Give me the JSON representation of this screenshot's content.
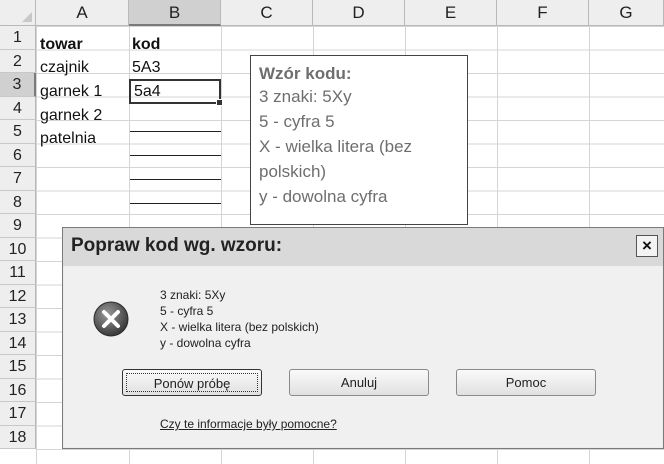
{
  "sheet": {
    "columns": [
      "A",
      "B",
      "C",
      "D",
      "E",
      "F",
      "G"
    ],
    "active_column": "B",
    "rows": [
      "1",
      "2",
      "3",
      "4",
      "5",
      "6",
      "7",
      "8",
      "9",
      "10",
      "11",
      "12",
      "13",
      "14",
      "15",
      "16",
      "17",
      "18"
    ],
    "active_row": "3",
    "cells": {
      "A1": "towar",
      "B1": "kod",
      "A2": "czajnik",
      "B2": "5A3",
      "A3": "garnek 1",
      "B3": "5a4",
      "A4": "garnek 2",
      "A5": "patelnia"
    }
  },
  "input_message": {
    "title": "Wzór kodu:",
    "lines": [
      "3 znaki: 5Xy",
      "5 - cyfra 5",
      "X - wielka litera (bez",
      "polskich)",
      "y - dowolna cyfra"
    ]
  },
  "error_dialog": {
    "title": "Popraw kod wg. wzoru:",
    "close_glyph": "×",
    "icon": "error-x-icon",
    "message_lines": [
      "3 znaki: 5Xy",
      "5 - cyfra 5",
      "X - wielka litera (bez polskich)",
      "y - dowolna cyfra"
    ],
    "buttons": {
      "retry": "Ponów próbę",
      "cancel": "Anuluj",
      "help": "Pomoc"
    },
    "help_link": "Czy te informacje były pomocne?"
  }
}
